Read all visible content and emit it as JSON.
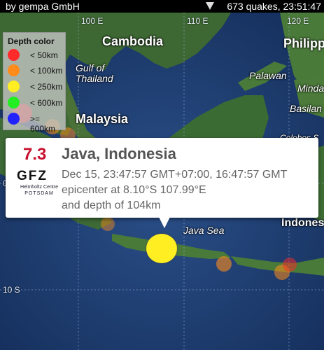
{
  "status_bar": {
    "left_text": "by gempa GmbH",
    "right_text": "673 quakes, 23:51:47"
  },
  "map": {
    "longitude_labels": [
      "100 E",
      "110 E",
      "120 E"
    ],
    "latitude_labels": [
      "0 N",
      "10 S"
    ],
    "places": {
      "cambodia": "Cambodia",
      "philippines": "Philipp",
      "gulf": "Gulf of\nThailand",
      "palawan": "Palawan",
      "mindanao": "Minda",
      "basilan": "Basilan",
      "malaysia": "Malaysia",
      "celebes": "Celebes S",
      "java_sea": "Java Sea",
      "indonesia": "Indones"
    },
    "colors": {
      "ocean": "#1e3f73",
      "land": "#3f6a35",
      "popup_magnitude": "#c8102e"
    }
  },
  "legend": {
    "title": "Depth color",
    "items": [
      {
        "label": "< 50km",
        "color": "#ff2a2a"
      },
      {
        "label": "< 100km",
        "color": "#ff8c1a"
      },
      {
        "label": "< 250km",
        "color": "#ffee22"
      },
      {
        "label": "< 600km",
        "color": "#22ee22"
      },
      {
        "label": ">= 600km",
        "color": "#2222ff"
      }
    ]
  },
  "popup": {
    "magnitude": "7.3",
    "region": "Java, Indonesia",
    "time_line": "Dec 15, 23:47:57 GMT+07:00, 16:47:57 GMT",
    "location_line": "epicenter at 8.10°S 107.99°E",
    "depth_line": "and depth of 104km",
    "logo": {
      "name": "GFZ",
      "subtitle": "Helmholtz Centre",
      "city": "POTSDAM"
    }
  }
}
